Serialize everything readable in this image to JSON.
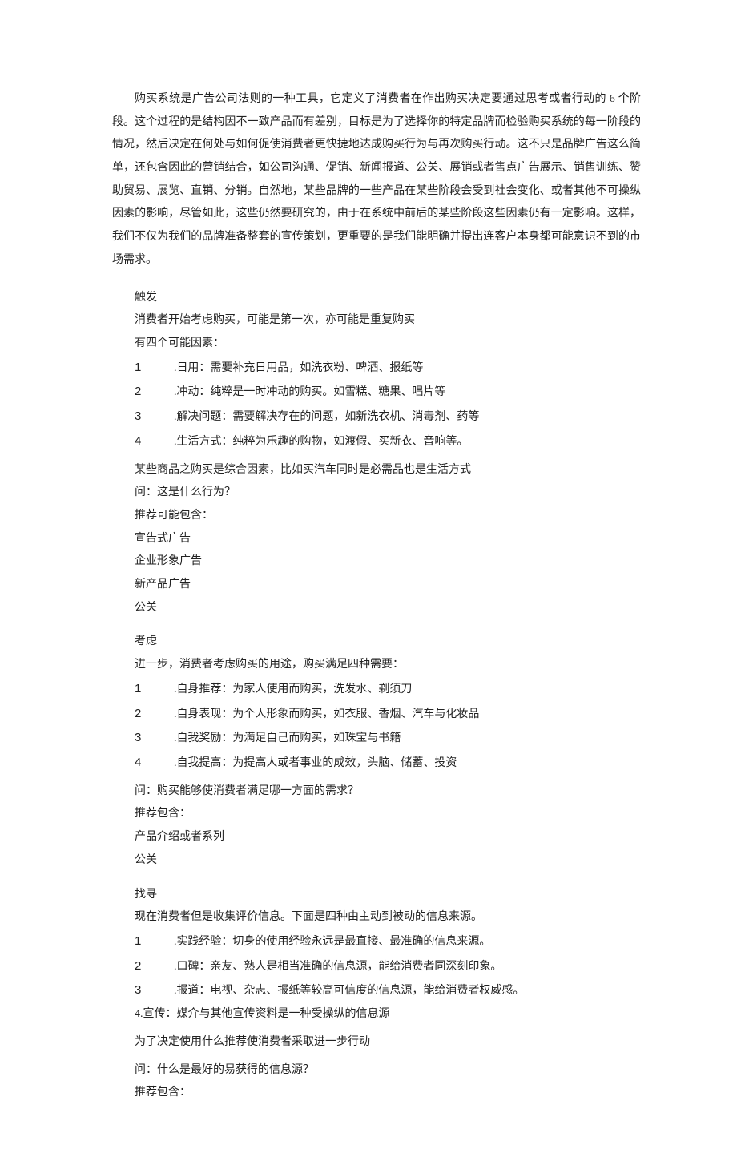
{
  "intro": "购买系统是广告公司法则的一种工具，它定义了消费者在作出购买决定要通过思考或者行动的 6 个阶段。这个过程的是结构因不一致产品而有差别，目标是为了选择你的特定品牌而检验购买系统的每一阶段的情况，然后决定在何处与如何促使消费者更快捷地达成购买行为与再次购买行动。这不只是品牌广告这么简单，还包含因此的营销结合，如公司沟通、促销、新闻报道、公关、展销或者售点广告展示、销售训练、赞助贸易、展览、直销、分销。自然地，某些品牌的一些产品在某些阶段会受到社会变化、或者其他不可操纵因素的影响，尽管如此，这些仍然要研究的，由于在系统中前后的某些阶段这些因素仍有一定影响。这样，我们不仅为我们的品牌准备整套的宣传策划，更重要的是我们能明确并提出连客户本身都可能意识不到的市场需求。",
  "sections": [
    {
      "title": "触发",
      "lead": [
        "消费者开始考虑购买，可能是第一次，亦可能是重复购买",
        "有四个可能因素："
      ],
      "items": [
        "日用：需要补充日用品，如洗衣粉、啤酒、报纸等",
        "冲动：纯粹是一时冲动的购买。如雪糕、糖果、唱片等",
        "解决问题：需要解决存在的问题，如新洗衣机、消毒剂、药等",
        "生活方式：纯粹为乐趣的购物，如渡假、买新衣、音响等。"
      ],
      "tail_top": "某些商品之购买是综合因素，比如买汽车同时是必需品也是生活方式",
      "question": "问：这是什么行为？",
      "rec_label": "推荐可能包含：",
      "recs": [
        "宣告式广告",
        "企业形象广告",
        "新产品广告",
        "公关"
      ]
    },
    {
      "title": "考虑",
      "lead": [
        "进一步，消费者考虑购买的用途，购买满足四种需要："
      ],
      "items": [
        "自身推荐：为家人使用而购买，洗发水、剃须刀",
        "自身表现：为个人形象而购买，如衣服、香烟、汽车与化妆品",
        "自我奖励：为满足自己而购买，如珠宝与书籍",
        "自我提高：为提高人或者事业的成效，头脑、储蓄、投资"
      ],
      "question": "问：购买能够使消费者满足哪一方面的需求？",
      "rec_label": "推荐包含：",
      "recs": [
        "产品介绍或者系列",
        "公关"
      ]
    },
    {
      "title": "找寻",
      "lead": [
        "现在消费者但是收集评价信息。下面是四种由主动到被动的信息来源。"
      ],
      "items": [
        "实践经验：切身的使用经验永远是最直接、最准确的信息来源。",
        "口碑：亲友、熟人是相当准确的信息源，能给消费者同深刻印象。",
        "报道：电视、杂志、报纸等较高可信度的信息源，能给消费者权威感。"
      ],
      "item4_compact": "4.宣传：媒介与其他宣传资料是一种受操纵的信息源",
      "tail_top": "为了决定使用什么推荐使消费者采取进一步行动",
      "question": "问：什么是最好的易获得的信息源？",
      "rec_label": "推荐包含："
    }
  ]
}
